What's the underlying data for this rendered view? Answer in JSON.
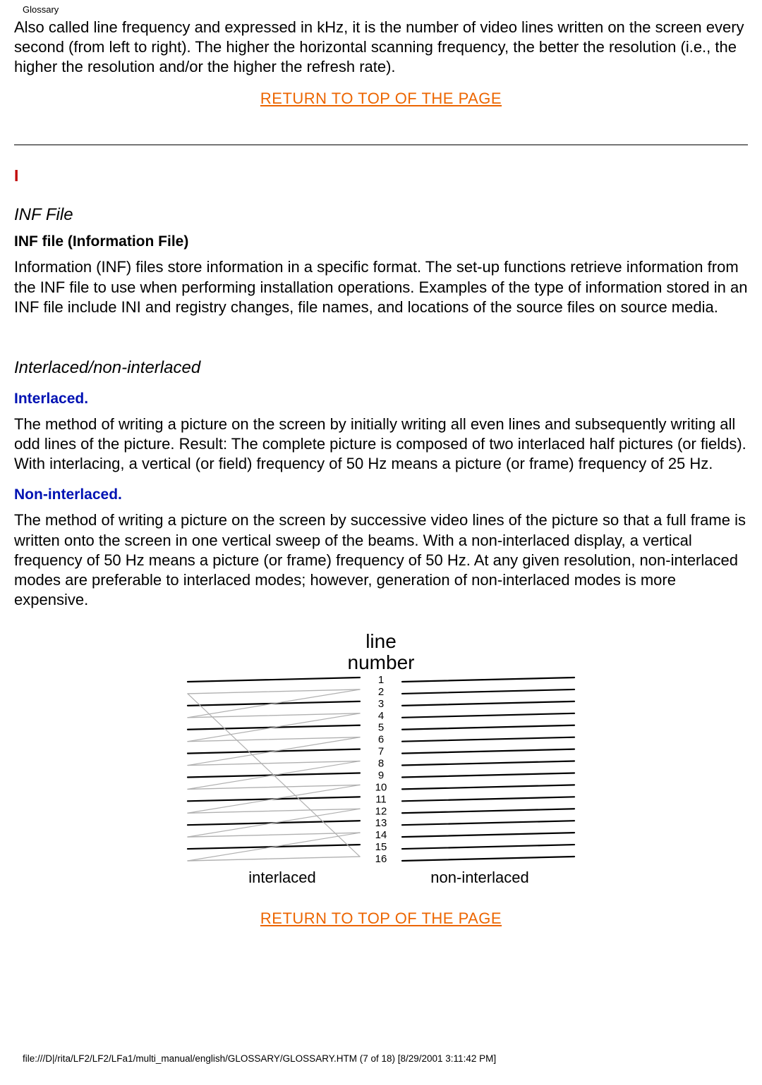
{
  "header": "Glossary",
  "intro_paragraph": "Also called line frequency and expressed in kHz, it is the number of video lines written on the screen every second (from left to right). The higher the horizontal scanning frequency, the better the resolution (i.e., the higher the resolution and/or the higher the refresh rate).",
  "return_link": "RETURN TO TOP OF THE PAGE",
  "section_letter": "I",
  "inf": {
    "title": "INF File",
    "subtitle": "INF file (Information File)",
    "paragraph": "Information (INF) files store information in a specific format. The set-up functions retrieve information from the INF file to use when performing installation operations. Examples of the type of information stored in an INF file include INI and registry changes, file names, and locations of the source files on source media."
  },
  "interlace": {
    "title": "Interlaced/non-interlaced",
    "interlaced_heading": "Interlaced.",
    "interlaced_paragraph": "The method of writing a picture on the screen by initially writing all even lines and subsequently writing all odd lines of the picture. Result: The complete picture is composed of two interlaced half pictures (or fields). With interlacing, a vertical (or field) frequency of 50 Hz means a picture (or frame) frequency of 25 Hz.",
    "noninterlaced_heading": "Non-interlaced.",
    "noninterlaced_paragraph": "The method of writing a picture on the screen by successive video lines of the picture so that a full frame is written onto the screen in one vertical sweep of the beams. With a non-interlaced display, a vertical frequency of 50 Hz means a picture (or frame) frequency of 50 Hz. At any given resolution, non-interlaced modes are preferable to interlaced modes; however, generation of non-interlaced modes is more expensive."
  },
  "figure": {
    "center_title_line1": "line",
    "center_title_line2": "number",
    "label_left": "interlaced",
    "label_right": "non-interlaced",
    "numbers": [
      "1",
      "2",
      "3",
      "4",
      "5",
      "6",
      "7",
      "8",
      "9",
      "10",
      "11",
      "12",
      "13",
      "14",
      "15",
      "16"
    ]
  },
  "return_link2": "RETURN TO TOP OF THE PAGE",
  "footer": "file:///D|/rita/LF2/LF2/LFa1/multi_manual/english/GLOSSARY/GLOSSARY.HTM (7 of 18) [8/29/2001 3:11:42 PM]"
}
